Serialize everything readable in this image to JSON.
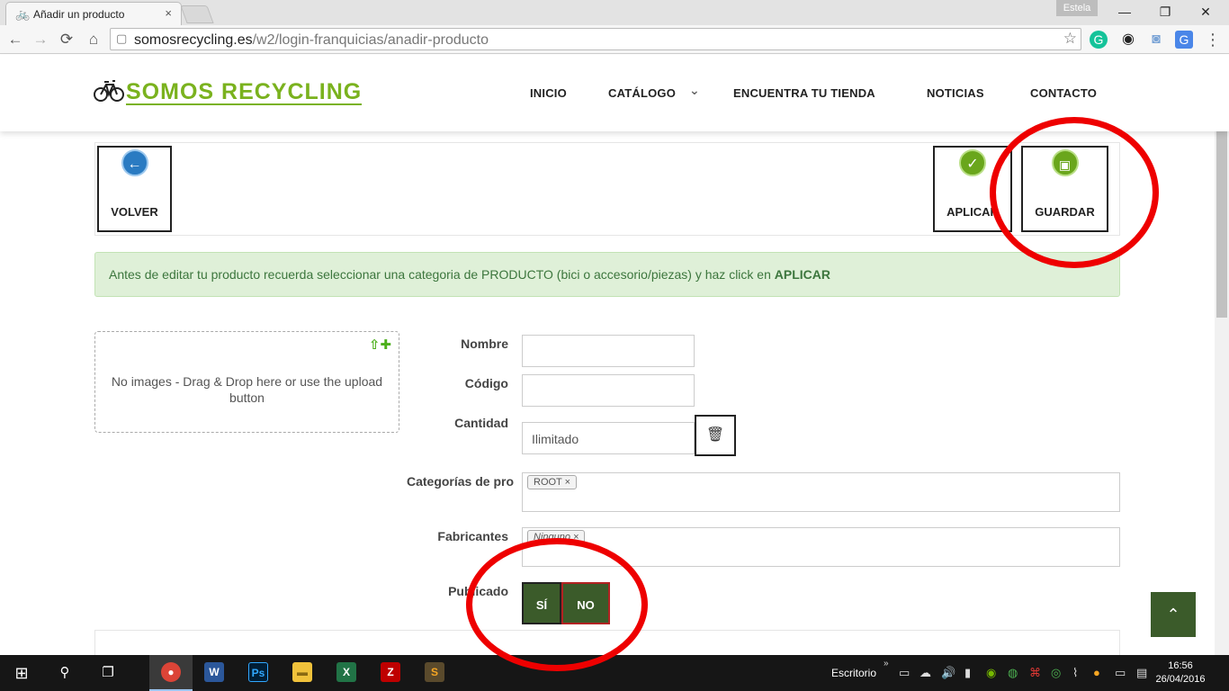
{
  "browser": {
    "tab_title": "Añadir un producto",
    "tab_close": "×",
    "tab_favicon": "bicycle-icon",
    "profile_name": "Estela",
    "window_controls": {
      "minimize": "—",
      "restore": "❐",
      "close": "✕"
    },
    "nav": {
      "back": "←",
      "forward": "→",
      "reload": "⟳",
      "home": "⌂"
    },
    "url_host": "somosrecycling.es",
    "url_path": "/w2/login-franquicias/anadir-producto",
    "star": "☆",
    "extensions": [
      {
        "name": "grammarly-icon",
        "glyph": "G",
        "color": "#15c39a"
      },
      {
        "name": "owl-icon",
        "glyph": "◉",
        "color": "#222222"
      },
      {
        "name": "camera-icon",
        "glyph": "◙",
        "color": "#7ba4d6"
      },
      {
        "name": "translate-icon",
        "glyph": "G",
        "color": "#4a86e8"
      },
      {
        "name": "menu-icon",
        "glyph": "⋮",
        "color": "#555555"
      }
    ]
  },
  "site": {
    "logo_text": "SOMOS RECYCLING",
    "nav": [
      "INICIO",
      "CATÁLOGO",
      "ENCUENTRA TU TIENDA",
      "NOTICIAS",
      "CONTACTO"
    ],
    "catalog_chevron": "⌄",
    "accent_color": "#7ab21e"
  },
  "actions": {
    "back_label": "VOLVER",
    "back_icon": "←",
    "apply_label": "APLICAR",
    "apply_icon": "✓",
    "save_label": "GUARDAR",
    "save_icon": "▣"
  },
  "alert": {
    "text": "Antes de editar tu producto recuerda seleccionar una categoria de PRODUCTO (bici o accesorio/piezas) y haz click en ",
    "strong": "APLICAR"
  },
  "dropzone": {
    "text": "No images - Drag & Drop here or use the upload button",
    "icons": "⇧✚"
  },
  "form": {
    "name_label": "Nombre",
    "name_value": "",
    "code_label": "Código",
    "code_value": "",
    "qty_label": "Cantidad",
    "qty_value": "Ilimitado",
    "trash_icon": "🗑",
    "cat_label": "Categorías de pro",
    "cat_tag": "ROOT ×",
    "mfr_label": "Fabricantes",
    "mfr_tag": "Ninguno ×",
    "pub_label": "Publicado",
    "pub_yes": "SÍ",
    "pub_no": "NO"
  },
  "back_to_top": "⌃",
  "taskbar": {
    "start": "⊞",
    "search": "⚲",
    "taskview": "❐",
    "apps": [
      {
        "name": "chrome-app",
        "glyph": "●",
        "color": "#db4437"
      },
      {
        "name": "word-app",
        "glyph": "W",
        "color": "#2b579a"
      },
      {
        "name": "photoshop-app",
        "glyph": "Ps",
        "color": "#001e36"
      },
      {
        "name": "explorer-app",
        "glyph": "▬",
        "color": "#f0c23b"
      },
      {
        "name": "excel-app",
        "glyph": "X",
        "color": "#217346"
      },
      {
        "name": "filezilla-app",
        "glyph": "Z",
        "color": "#bf0000"
      },
      {
        "name": "sublime-app",
        "glyph": "S",
        "color": "#5a4a2c"
      }
    ],
    "desktop_label": "Escritorio",
    "time": "16:56",
    "date": "26/04/2016"
  }
}
